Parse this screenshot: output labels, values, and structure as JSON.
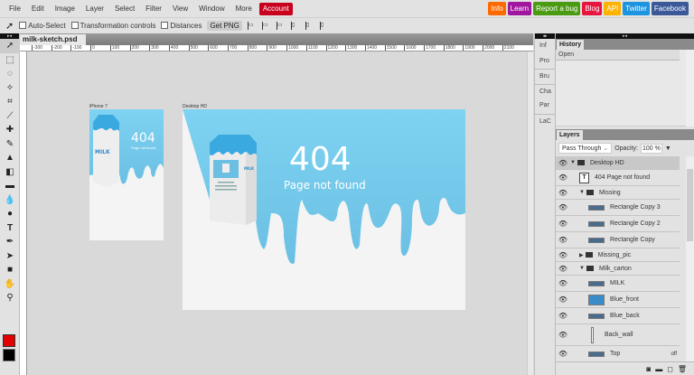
{
  "menu": [
    "File",
    "Edit",
    "Image",
    "Layer",
    "Select",
    "Filter",
    "View",
    "Window",
    "More"
  ],
  "account": "Account",
  "links": [
    {
      "label": "Info",
      "color": "#ff6a00"
    },
    {
      "label": "Learn",
      "color": "#a0169e"
    },
    {
      "label": "Report a bug",
      "color": "#4a9a12"
    },
    {
      "label": "Blog",
      "color": "#e6163e"
    },
    {
      "label": "API",
      "color": "#ffb300"
    },
    {
      "label": "Twitter",
      "color": "#1c94e0"
    },
    {
      "label": "Facebook",
      "color": "#3b5998"
    }
  ],
  "options": {
    "auto_select": "Auto-Select",
    "transform": "Transformation controls",
    "distances": "Distances",
    "get_png": "Get PNG"
  },
  "document": {
    "tab": "milk-sketch.psd",
    "close": "✕"
  },
  "ruler": [
    "-300",
    "-200",
    "-100",
    "0",
    "100",
    "200",
    "300",
    "400",
    "500",
    "600",
    "700",
    "800",
    "900",
    "1000",
    "1100",
    "1200",
    "1300",
    "1400",
    "1500",
    "1600",
    "1700",
    "1800",
    "1900",
    "2000",
    "2100"
  ],
  "artboards": {
    "phone": {
      "label": "iPhone 7",
      "title": "404",
      "subtitle": "Page not found",
      "brand": "MILK"
    },
    "desktop": {
      "label": "Desktop HD",
      "title": "404",
      "subtitle": "Page not found",
      "brand": "MILK"
    }
  },
  "mini_panels": [
    "Inf",
    "Pro",
    "Bru",
    "Cha",
    "Par",
    "LaC"
  ],
  "history": {
    "tab": "History",
    "items": [
      "Open"
    ]
  },
  "layers_panel": {
    "tab": "Layers",
    "blend": "Pass Through",
    "opacity_label": "Opacity:",
    "opacity": "100 %",
    "off": "off"
  },
  "layers": [
    {
      "name": "Desktop HD",
      "type": "group",
      "indent": 0
    },
    {
      "name": "404 Page not found",
      "type": "text",
      "indent": 1
    },
    {
      "name": "Missing",
      "type": "group",
      "indent": 1
    },
    {
      "name": "Rectangle Copy 3",
      "type": "layer",
      "indent": 2
    },
    {
      "name": "Rectangle Copy 2",
      "type": "layer",
      "indent": 2
    },
    {
      "name": "Rectangle Copy",
      "type": "layer",
      "indent": 2
    },
    {
      "name": "Missing_pic",
      "type": "group-closed",
      "indent": 1
    },
    {
      "name": "Milk_carton",
      "type": "group",
      "indent": 1
    },
    {
      "name": "MILK",
      "type": "layer",
      "indent": 2
    },
    {
      "name": "Blue_front",
      "type": "layer",
      "indent": 2
    },
    {
      "name": "Blue_back",
      "type": "layer",
      "indent": 2
    },
    {
      "name": "Back_wall",
      "type": "layer",
      "indent": 2
    },
    {
      "name": "Top",
      "type": "layer",
      "indent": 2
    }
  ]
}
